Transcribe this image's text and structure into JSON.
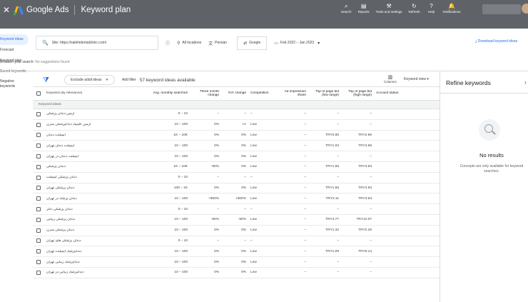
{
  "topbar": {
    "close_icon": "close-icon",
    "brand": "Google Ads",
    "page_title": "Keyword plan",
    "tools": [
      {
        "icon": "search-icon",
        "glyph": "⌕",
        "label": "Search"
      },
      {
        "icon": "reports-icon",
        "glyph": "▤",
        "label": "Reports"
      },
      {
        "icon": "wrench-icon",
        "glyph": "⚒",
        "label": "Tools and settings"
      },
      {
        "icon": "refresh-icon",
        "glyph": "↻",
        "label": "Refresh"
      },
      {
        "icon": "help-icon",
        "glyph": "?",
        "label": "Help"
      },
      {
        "icon": "bell-icon",
        "glyph": "🔔",
        "label": "Notifications"
      }
    ],
    "colors": {
      "bar": "#5f6368",
      "accent": "#1a73e8"
    }
  },
  "sidebar": {
    "items": [
      {
        "label": "Keyword ideas",
        "active": true
      },
      {
        "label": "Forecast",
        "active": false
      },
      {
        "label": "Keyword plan",
        "active": false
      },
      {
        "label": "Saved keywords",
        "active": false
      },
      {
        "label": "Negative keywords",
        "active": false
      }
    ]
  },
  "search": {
    "value": "Site: https://salehidentalclinic.com/",
    "location": "All locations",
    "language": "Persian",
    "network": "Google",
    "date_range": "Feb 2022 – Jan 2023",
    "download_label": "Download keyword ideas"
  },
  "broaden": {
    "label": "Broaden your search:",
    "value": "No suggestions found"
  },
  "toolbar": {
    "exclude_adult": "Exclude adult ideas",
    "add_filter": "Add filter",
    "count_text": "57 keyword ideas available",
    "columns_label": "Columns",
    "view_label": "Keyword view"
  },
  "table": {
    "headers": {
      "keyword": "Keyword (by relevance)",
      "avg": "Avg. monthly searches",
      "three_month": "Three month change",
      "yoy": "YoY change",
      "competition": "Competition",
      "ad_impr": "Ad impression share",
      "low_bid": "Top of page bid (low range)",
      "high_bid": "Top of page bid (high range)",
      "status": "Account status"
    },
    "group_label": "Keyword ideas",
    "rows": [
      {
        "kw": "آرمین دندان پزشکی",
        "avg": "0 – 10",
        "m3": "–",
        "yoy": "–",
        "comp": "–",
        "ais": "–",
        "low": "–",
        "high": "–"
      },
      {
        "kw": "آرمین کلینیک دندانپزشکی مدرن",
        "avg": "10 – 100",
        "m3": "0%",
        "yoy": "+∞",
        "comp": "Low",
        "ais": "–",
        "low": "–",
        "high": "–"
      },
      {
        "kw": "ایمپلنت دندان",
        "avg": "1K – 10K",
        "m3": "0%",
        "yoy": "0%",
        "comp": "Low",
        "ais": "–",
        "low": "TRY0.85",
        "high": "TRY2.96"
      },
      {
        "kw": "ایمپلنت دندان تهران",
        "avg": "10 – 100",
        "m3": "0%",
        "yoy": "0%",
        "comp": "Low",
        "ais": "–",
        "low": "TRY1.03",
        "high": "TRY4.68"
      },
      {
        "kw": "ایمپلنت دندان در تهران",
        "avg": "10 – 100",
        "m3": "0%",
        "yoy": "0%",
        "comp": "Low",
        "ais": "–",
        "low": "–",
        "high": "–"
      },
      {
        "kw": "دندان پزشکی",
        "avg": "1K – 10K",
        "m3": "-90%",
        "yoy": "0%",
        "comp": "Low",
        "ais": "–",
        "low": "TRY1.55",
        "high": "TRY4.93"
      },
      {
        "kw": "دندان پزشکی ایمپلنت",
        "avg": "0 – 10",
        "m3": "–",
        "yoy": "–",
        "comp": "–",
        "ais": "–",
        "low": "–",
        "high": "–"
      },
      {
        "kw": "دندان پزشکی تهران",
        "avg": "100 – 1K",
        "m3": "0%",
        "yoy": "0%",
        "comp": "Low",
        "ais": "–",
        "low": "TRY1.55",
        "high": "TRY4.93"
      },
      {
        "kw": "دندان پزشک در تهران",
        "avg": "10 – 100",
        "m3": "+900%",
        "yoy": "+900%",
        "comp": "Low",
        "ais": "–",
        "low": "TRY2.11",
        "high": "TRY4.63"
      },
      {
        "kw": "دندان پزشکی دکتر",
        "avg": "0 – 10",
        "m3": "–",
        "yoy": "–",
        "comp": "–",
        "ais": "–",
        "low": "–",
        "high": "–"
      },
      {
        "kw": "دندان پزشکی زیبایی",
        "avg": "10 – 100",
        "m3": "-90%",
        "yoy": "-90%",
        "comp": "Low",
        "ais": "–",
        "low": "TRY4.77",
        "high": "TRY12.07"
      },
      {
        "kw": "دندان پزشکی مدرن",
        "avg": "10 – 100",
        "m3": "0%",
        "yoy": "0%",
        "comp": "Low",
        "ais": "–",
        "low": "TRY1.32",
        "high": "TRY2.26"
      },
      {
        "kw": "دندان پزشکی های تهران",
        "avg": "0 – 10",
        "m3": "–",
        "yoy": "–",
        "comp": "–",
        "ais": "–",
        "low": "–",
        "high": "–"
      },
      {
        "kw": "دندانپزشک ایمپلنت تهران",
        "avg": "10 – 100",
        "m3": "0%",
        "yoy": "0%",
        "comp": "Low",
        "ais": "–",
        "low": "TRY1.09",
        "high": "TRY5.14"
      },
      {
        "kw": "دندانپزشک زیبایی تهران",
        "avg": "10 – 100",
        "m3": "0%",
        "yoy": "0%",
        "comp": "Low",
        "ais": "–",
        "low": "–",
        "high": "–"
      },
      {
        "kw": "دندانپزشک زیبایی در تهران",
        "avg": "10 – 100",
        "m3": "0%",
        "yoy": "0%",
        "comp": "Low",
        "ais": "–",
        "low": "–",
        "high": "–"
      }
    ]
  },
  "refine": {
    "title": "Refine keywords",
    "no_results": "No results",
    "desc": "Concepts are only available for keyword searches."
  }
}
